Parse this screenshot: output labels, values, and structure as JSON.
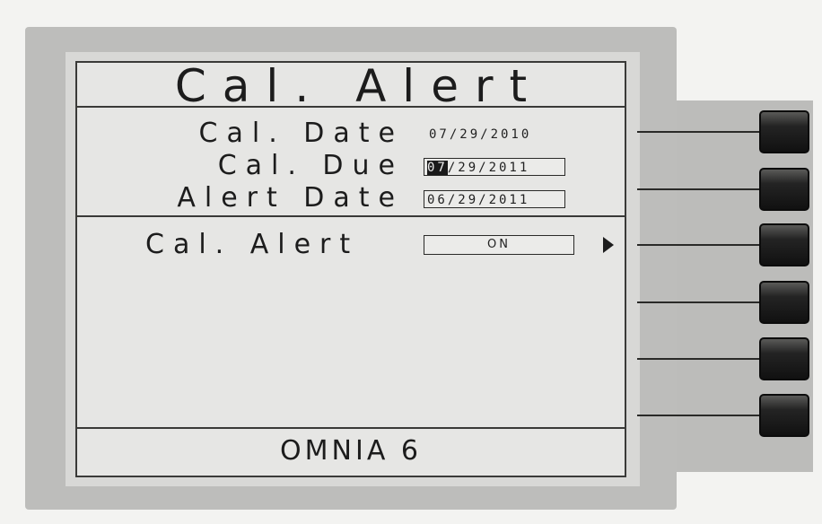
{
  "screen": {
    "title": "Cal. Alert",
    "fields": [
      {
        "label": "Cal. Date",
        "value": "07/29/2010"
      },
      {
        "label": "Cal. Due",
        "value_highlight": "07",
        "value_rest": "/29/2011"
      },
      {
        "label": "Alert Date",
        "value": "06/29/2011"
      }
    ],
    "alert": {
      "label": "Cal. Alert",
      "value": "ON"
    },
    "footer": "OMNIA 6"
  },
  "softkeys": [
    {
      "icon": "softkey-button"
    },
    {
      "icon": "softkey-button"
    },
    {
      "icon": "softkey-button"
    },
    {
      "icon": "softkey-button"
    },
    {
      "icon": "softkey-button"
    },
    {
      "icon": "softkey-button"
    }
  ]
}
